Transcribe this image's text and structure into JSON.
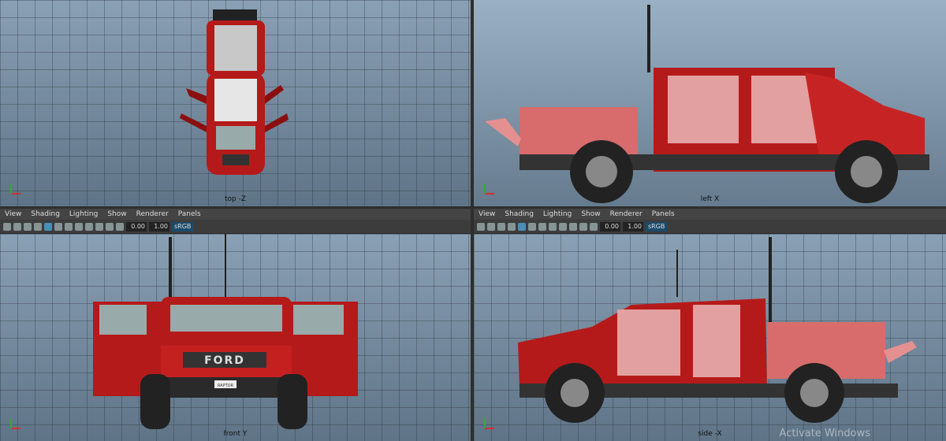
{
  "viewports": {
    "top": {
      "label": "top -Z"
    },
    "left": {
      "label": "left X"
    },
    "front": {
      "label": "front Y"
    },
    "side": {
      "label": "side -X"
    }
  },
  "menu": [
    "View",
    "Shading",
    "Lighting",
    "Show",
    "Renderer",
    "Panels"
  ],
  "toolbar": {
    "value1": "0.00",
    "value2": "1.00",
    "colorspace": "sRGB"
  },
  "vehicle": {
    "grille_text": "FORD",
    "plate_text": "RAPTOR"
  },
  "watermark": "Activate Windows",
  "colors": {
    "body_red": "#b51a1a",
    "grid_bg": "#7f95a9",
    "menu_bg": "#444444"
  }
}
